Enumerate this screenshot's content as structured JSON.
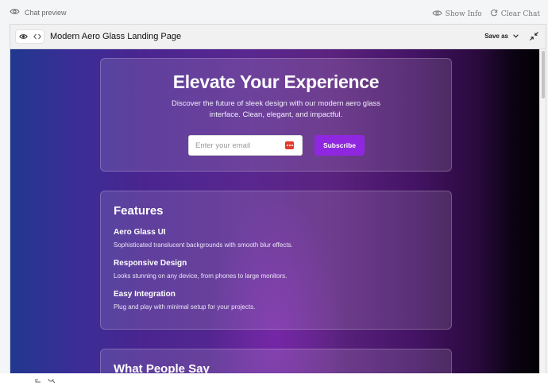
{
  "topbar": {
    "chat_preview": "Chat preview",
    "show_info": "Show Info",
    "clear_chat": "Clear Chat"
  },
  "window": {
    "title": "Modern Aero Glass Landing Page",
    "save_as": "Save as"
  },
  "hero": {
    "heading": "Elevate Your Experience",
    "subtitle": "Discover the future of sleek design with our modern aero glass interface. Clean, elegant, and impactful.",
    "email_placeholder": "Enter your email",
    "subscribe_label": "Subscribe"
  },
  "features": {
    "heading": "Features",
    "items": [
      {
        "title": "Aero Glass UI",
        "desc": "Sophisticated translucent backgrounds with smooth blur effects."
      },
      {
        "title": "Responsive Design",
        "desc": "Looks stunning on any device, from phones to large monitors."
      },
      {
        "title": "Easy Integration",
        "desc": "Plug and play with minimal setup for your projects."
      }
    ]
  },
  "testimonials": {
    "heading": "What People Say"
  },
  "icons": {
    "eye": "eye-icon",
    "code": "code-icon",
    "info": "eye-icon",
    "refresh": "refresh-icon",
    "chevron": "chevron-down-icon",
    "collapse": "collapse-icon",
    "password_manager": "password-manager-icon",
    "copy": "copy-icon",
    "zoom": "zoom-icon"
  },
  "colors": {
    "subscribe_button": "#9027e0",
    "password_icon": "#e23b2e"
  }
}
